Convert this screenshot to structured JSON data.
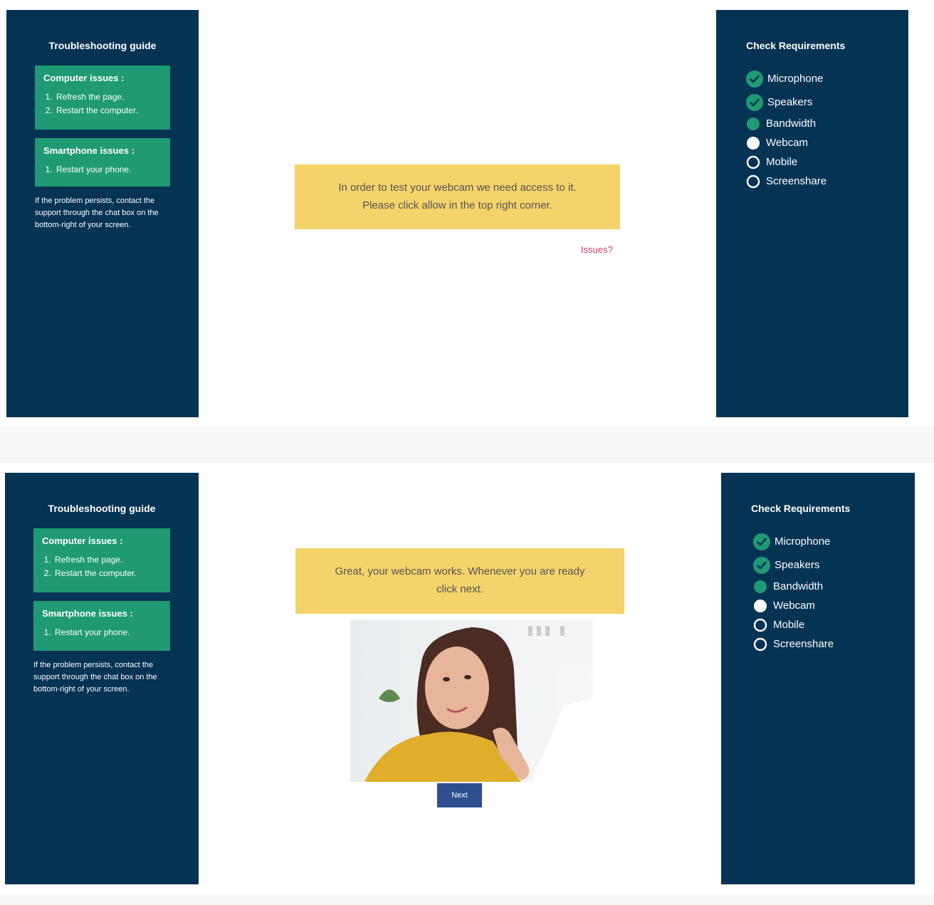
{
  "screen_1": {
    "troubleshooting": {
      "title": "Troubleshooting guide",
      "computer": {
        "title": "Computer issues :",
        "steps": [
          "Refresh the page.",
          "Restart the computer."
        ]
      },
      "smartphone": {
        "title": "Smartphone issues :",
        "steps": [
          "Restart your phone."
        ]
      },
      "persist_text": "If the problem persists, contact the support through the chat box on the bottom-right of your screen."
    },
    "notice_line1": "In order to test your webcam we need access to it.",
    "notice_line2": "Please click allow in the top right corner.",
    "issues_link": "Issues?",
    "requirements": {
      "title": "Check Requirements",
      "items": [
        {
          "label": "Microphone",
          "status": "checked",
          "icon": "check-circle-icon"
        },
        {
          "label": "Speakers",
          "status": "checked",
          "icon": "check-circle-icon"
        },
        {
          "label": "Bandwidth",
          "status": "in-progress",
          "icon": "filled-green-circle-icon"
        },
        {
          "label": "Webcam",
          "status": "current",
          "icon": "filled-white-circle-icon"
        },
        {
          "label": "Mobile",
          "status": "pending",
          "icon": "empty-circle-icon"
        },
        {
          "label": "Screenshare",
          "status": "pending",
          "icon": "empty-circle-icon"
        }
      ]
    }
  },
  "screen_2": {
    "troubleshooting": {
      "title": "Troubleshooting guide",
      "computer": {
        "title": "Computer issues :",
        "steps": [
          "Refresh the page.",
          "Restart the computer."
        ]
      },
      "smartphone": {
        "title": "Smartphone issues :",
        "steps": [
          "Restart your phone."
        ]
      },
      "persist_text": "If the problem persists, contact the support through the chat box on the bottom-right of your screen."
    },
    "notice_line1": "Great, your webcam works. Whenever you are ready",
    "notice_line2": "click next.",
    "next_button": "Next",
    "requirements": {
      "title": "Check Requirements",
      "items": [
        {
          "label": "Microphone",
          "status": "checked",
          "icon": "check-circle-icon"
        },
        {
          "label": "Speakers",
          "status": "checked",
          "icon": "check-circle-icon"
        },
        {
          "label": "Bandwidth",
          "status": "in-progress",
          "icon": "filled-green-circle-icon"
        },
        {
          "label": "Webcam",
          "status": "current",
          "icon": "filled-white-circle-icon"
        },
        {
          "label": "Mobile",
          "status": "pending",
          "icon": "empty-circle-icon"
        },
        {
          "label": "Screenshare",
          "status": "pending",
          "icon": "empty-circle-icon"
        }
      ]
    }
  },
  "colors": {
    "sidebar_bg": "#053354",
    "issue_box": "#1f9a73",
    "notice_bg": "#f4d36a",
    "issues_link": "#c3425a",
    "next_button": "#2e4f8f"
  }
}
